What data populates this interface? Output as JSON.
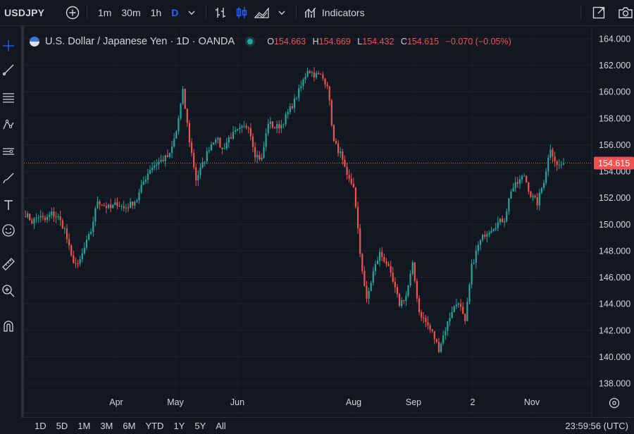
{
  "toolbar": {
    "symbol": "USDJPY",
    "timeframes": [
      "1m",
      "30m",
      "1h",
      "D"
    ],
    "active_timeframe": "D",
    "indicators_label": "Indicators"
  },
  "legend": {
    "title": "U.S. Dollar / Japanese Yen · 1D · OANDA",
    "open_label": "O",
    "open": "154.663",
    "high_label": "H",
    "high": "154.669",
    "low_label": "L",
    "low": "154.432",
    "close_label": "C",
    "close": "154.615",
    "change": "−0.070 (−0.05%)"
  },
  "bottom": {
    "ranges": [
      "1D",
      "5D",
      "1M",
      "3M",
      "6M",
      "YTD",
      "1Y",
      "5Y",
      "All"
    ],
    "clock": "23:59:56 (UTC)"
  },
  "colors": {
    "up": "#26a69a",
    "down": "#ef5350",
    "background": "#131722",
    "last_price": "#ef5350"
  },
  "chart_data": {
    "type": "candlestick",
    "y_ticks": [
      "164.000",
      "162.000",
      "160.000",
      "158.000",
      "156.000",
      "154.000",
      "152.000",
      "150.000",
      "148.000",
      "146.000",
      "144.000",
      "142.000",
      "140.000",
      "138.000"
    ],
    "ylim": [
      137.2,
      164.8
    ],
    "x_ticks": [
      "Apr",
      "May",
      "Jun",
      "Aug",
      "Sep",
      "2",
      "Nov"
    ],
    "last_price": 154.615,
    "last_price_label": "154.615",
    "anchors": [
      150.8,
      150.2,
      150.6,
      150.3,
      150.8,
      150.5,
      149.6,
      147.5,
      146.8,
      148.2,
      149.5,
      151.8,
      151.4,
      151.2,
      151.6,
      151.2,
      151.5,
      151.9,
      153.2,
      154.2,
      154.6,
      154.9,
      155.2,
      157.0,
      160.0,
      156.3,
      153.4,
      154.5,
      155.8,
      156.6,
      155.6,
      156.5,
      156.9,
      157.2,
      157.5,
      155.3,
      154.9,
      157.7,
      157.3,
      157.5,
      158.4,
      159.3,
      160.4,
      161.7,
      161.3,
      161.2,
      160.6,
      156.2,
      155.3,
      153.5,
      152.9,
      147.8,
      144.2,
      146.4,
      147.8,
      147.1,
      145.6,
      144.0,
      144.6,
      146.9,
      143.4,
      142.6,
      141.8,
      140.6,
      142.1,
      143.5,
      144.2,
      142.5,
      146.8,
      148.4,
      149.3,
      149.7,
      150.1,
      150.4,
      152.6,
      153.1,
      153.7,
      152.2,
      151.6,
      153.3,
      155.8,
      154.4,
      154.6
    ],
    "first_open": 150.6
  }
}
